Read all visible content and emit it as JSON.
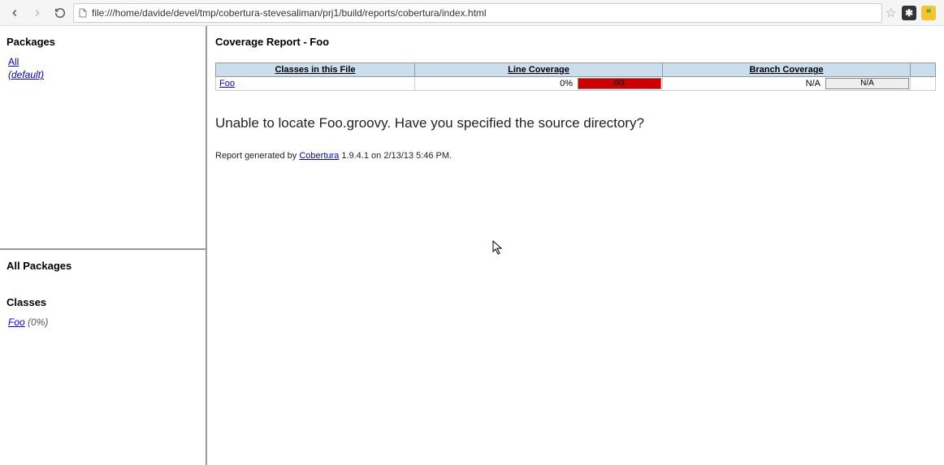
{
  "browser": {
    "url": "file:///home/davide/devel/tmp/cobertura-stevesaliman/prj1/build/reports/cobertura/index.html"
  },
  "sidebar_top": {
    "title": "Packages",
    "links": {
      "all": "All",
      "default": "(default)"
    }
  },
  "sidebar_bottom": {
    "title_all": "All Packages",
    "title_classes": "Classes",
    "class_link": "Foo",
    "class_pct": "(0%)"
  },
  "main": {
    "title": "Coverage Report - Foo",
    "headers": {
      "classes": "Classes in this File",
      "line": "Line Coverage",
      "branch": "Branch Coverage"
    },
    "row": {
      "class_name": "Foo",
      "line_pct": "0%",
      "line_bar_text": "0/1",
      "line_bar_width_pct": 100,
      "branch_pct": "N/A",
      "branch_bar_text": "N/A",
      "branch_bar_width_pct": 0
    },
    "error": "Unable to locate Foo.groovy. Have you specified the source directory?",
    "footer_prefix": "Report generated by ",
    "footer_tool": "Cobertura",
    "footer_suffix": " 1.9.4.1 on 2/13/13 5:46 PM."
  }
}
